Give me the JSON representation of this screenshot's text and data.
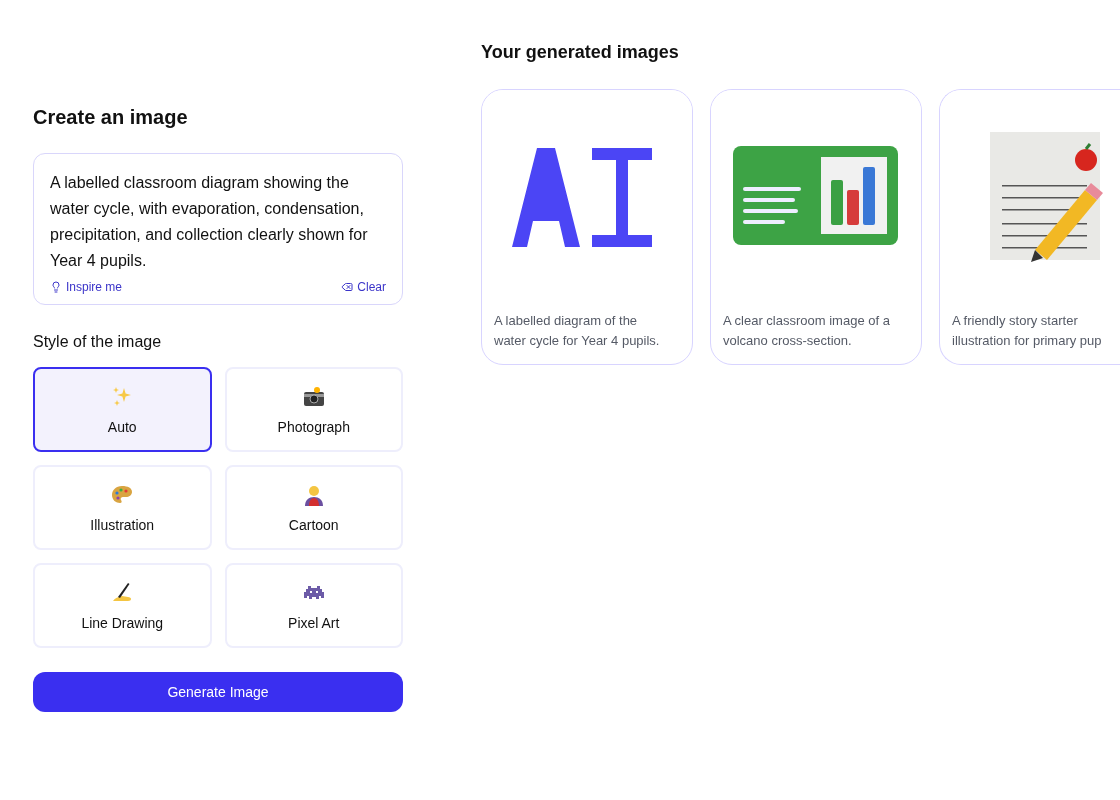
{
  "create_panel": {
    "title": "Create an image",
    "prompt": {
      "value": "A labelled classroom diagram showing the water cycle, with evaporation, condensation, precipitation, and collection clearly shown for Year 4 pupils.",
      "inspire_label": "Inspire me",
      "clear_label": "Clear"
    },
    "style_title": "Style of the image",
    "styles": [
      {
        "kind": "sparkles",
        "label": "Auto",
        "selected": true
      },
      {
        "kind": "camera",
        "label": "Photograph",
        "selected": false
      },
      {
        "kind": "palette",
        "label": "Illustration",
        "selected": false
      },
      {
        "kind": "hero",
        "label": "Cartoon",
        "selected": false
      },
      {
        "kind": "pen",
        "label": "Line Drawing",
        "selected": false
      },
      {
        "kind": "alien",
        "label": "Pixel Art",
        "selected": false
      }
    ],
    "generate_label": "Generate Image"
  },
  "gallery": {
    "title": "Your generated images",
    "cards": [
      {
        "kind": "letters",
        "lines": [
          "A labelled diagram of the",
          "water cycle for Year 4 pupils."
        ]
      },
      {
        "kind": "slides",
        "lines": [
          "A clear classroom image of a",
          "volcano cross-section."
        ]
      },
      {
        "kind": "notepad",
        "lines": [
          "A friendly story starter",
          "illustration for primary pup"
        ]
      }
    ]
  }
}
